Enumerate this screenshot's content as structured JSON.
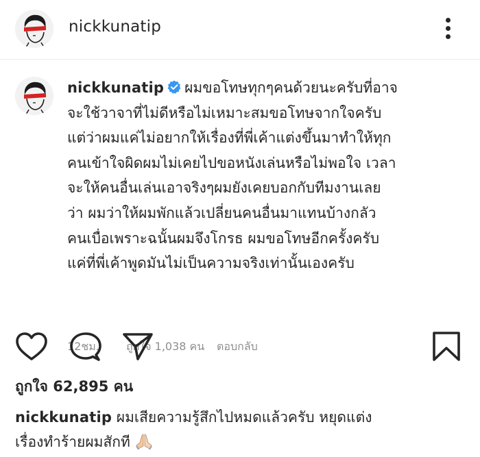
{
  "post": {
    "username": "nickkunatip"
  },
  "comment": {
    "username": "nickkunatip",
    "lines": [
      "ผมขอโทษทุกๆคนด้วยนะครับที่อาจ",
      "จะใช้วาจาที่ไม่ดีหรือไม่เหมาะสมขอโทษจากใจครับ",
      "แต่ว่าผมแค่ไม่อยากให้เรื่องที่พี่เค้าแต่งขึ้นมาทำให้ทุก",
      "คนเข้าใจผิดผมไม่เคยไปขอหนังเล่นหรือไม่พอใจ เวลา",
      "จะให้คนอื่นเล่นเอาจริงๆผมยังเคยบอกกับทีมงานเลย",
      "ว่า ผมว่าให้ผมพักแล้วเปลี่ยนคนอื่นมาแทนบ้างกลัว",
      "คนเบื่อเพราะฉนั้นผมจึงโกรธ ผมขอโทษอีกครั้งครับ",
      "แค่ที่พี่เค้าพูดมันไม่เป็นความจริงเท่านั้นเองครับ"
    ],
    "time": "12ชม.",
    "likes": "ถูกใจ 1,038 คน",
    "reply_label": "ตอบกลับ"
  },
  "likes_total": "ถูกใจ 62,895 คน",
  "caption": {
    "username": "nickkunatip",
    "lines": [
      "ผมเสียความรู้สึกไปหมดแล้วครับ หยุดแต่ง",
      "เรื่องทำร้ายผมสักที"
    ],
    "emoji": "folded-hands-icon"
  },
  "colors": {
    "text": "#262626",
    "muted": "#8e8e8e",
    "verified": "#3897f0"
  }
}
